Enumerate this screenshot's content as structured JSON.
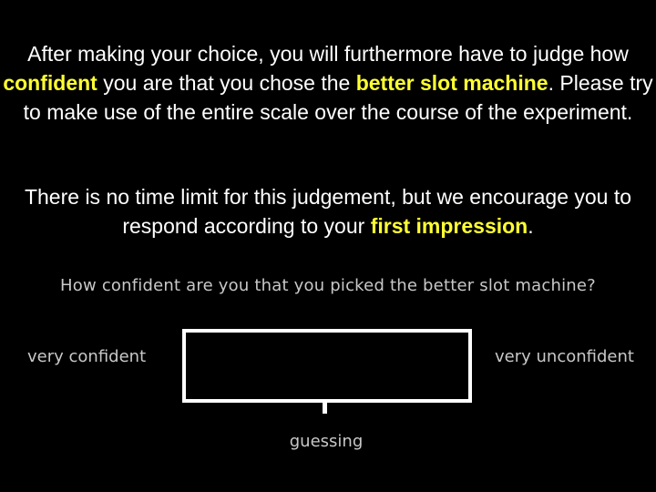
{
  "instructions": {
    "paragraph1": {
      "part1": "After making your choice, you will furthermore have to judge how ",
      "highlight1": "confident",
      "part2": " you are that you chose the ",
      "highlight2": "better slot machine",
      "part3": ". Please try to make use of the entire scale over the course of the experiment."
    },
    "paragraph2": {
      "part1": "There is no time limit for this judgement, but we encourage you to respond according to your ",
      "highlight1": "first impression",
      "part2": "."
    }
  },
  "scale": {
    "question": "How confident are you that you picked the better slot machine?",
    "left_label": "very confident",
    "right_label": "very unconfident",
    "mid_label": "guessing"
  },
  "colors": {
    "background": "#000000",
    "text": "#ffffff",
    "highlight": "#ffff33",
    "scale_text": "#c8c8c8"
  }
}
